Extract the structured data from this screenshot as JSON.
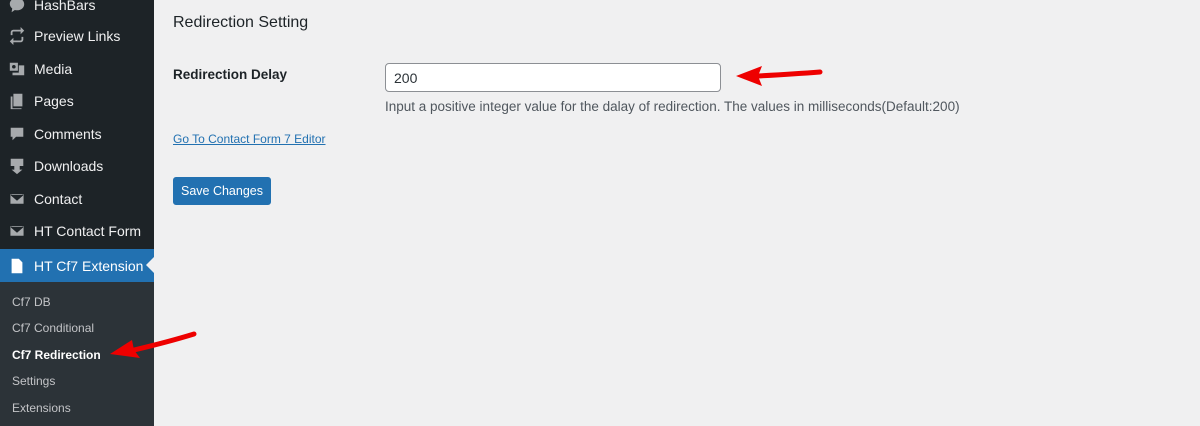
{
  "sidebar": {
    "items": [
      {
        "label": "HashBars",
        "icon": "hashbars-icon"
      },
      {
        "label": "Preview Links",
        "icon": "link-icon"
      },
      {
        "label": "Media",
        "icon": "media-icon"
      },
      {
        "label": "Pages",
        "icon": "pages-icon"
      },
      {
        "label": "Comments",
        "icon": "comment-icon"
      },
      {
        "label": "Downloads",
        "icon": "download-icon"
      },
      {
        "label": "Contact",
        "icon": "envelope-icon"
      },
      {
        "label": "HT Contact Form",
        "icon": "envelope-icon"
      },
      {
        "label": "HT Cf7 Extension",
        "icon": "document-icon",
        "current": true
      }
    ],
    "submenu": [
      {
        "label": "Cf7 DB"
      },
      {
        "label": "Cf7 Conditional"
      },
      {
        "label": "Cf7 Redirection",
        "active": true
      },
      {
        "label": "Settings"
      },
      {
        "label": "Extensions"
      }
    ]
  },
  "main": {
    "title": "Redirection Setting",
    "delay_label": "Redirection Delay",
    "delay_value": "200",
    "delay_description": "Input a positive integer value for the dalay of redirection. The values in milliseconds(Default:200)",
    "editor_link": "Go To Contact Form 7 Editor",
    "save_label": "Save Changes"
  },
  "colors": {
    "sidebar_bg": "#1d2327",
    "submenu_bg": "#2c3338",
    "accent": "#2271b1",
    "arrow": "#ee0000"
  }
}
